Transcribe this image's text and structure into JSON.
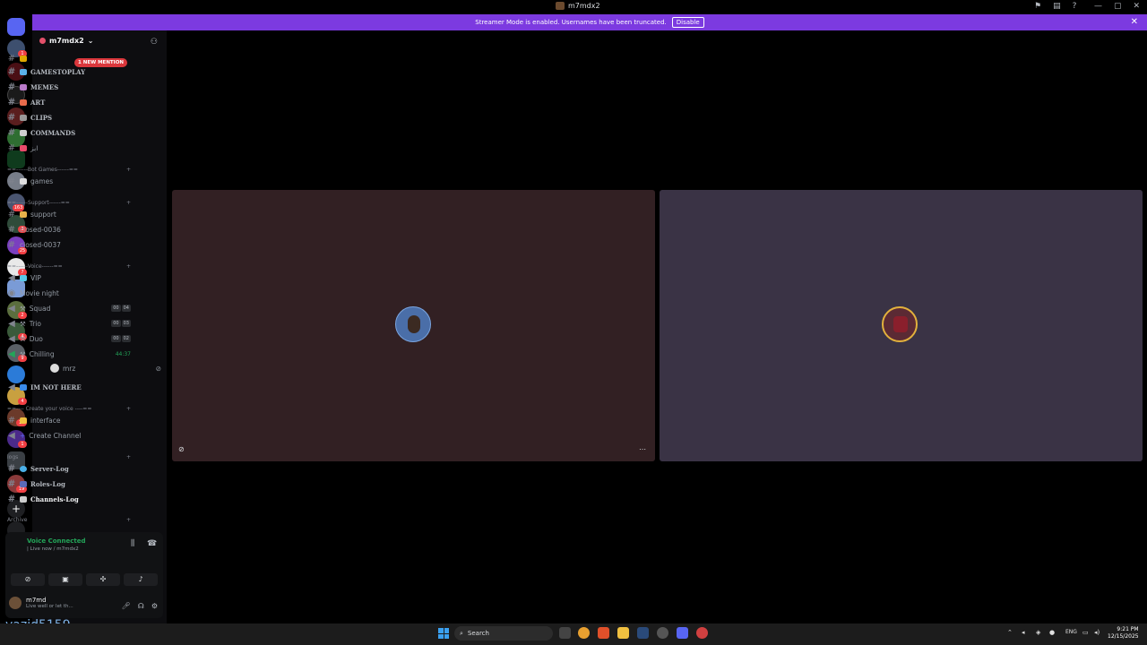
{
  "window": {
    "title": "m7mdx2"
  },
  "banner": {
    "text": "Streamer Mode is enabled. Usernames have been truncated.",
    "button": "Disable"
  },
  "server": {
    "name": "m7mdx2"
  },
  "mention_pill": "1 NEW MENTION",
  "guild_badges": [
    "1",
    "3",
    "163",
    "3",
    "25",
    "7",
    "2",
    "4",
    "9",
    "4",
    "18",
    "1",
    "19"
  ],
  "channels": {
    "top": [
      "GAMESTOPLAY",
      "MEMES",
      "ART",
      "CLIPS",
      "COMMANDS",
      "ابز"
    ],
    "cat_botgames": "==------Bot Games------==",
    "botgames": [
      "games"
    ],
    "cat_support": "==------Support------==",
    "support": [
      "support",
      "closed-0036",
      "closed-0037"
    ],
    "cat_voice": "==------Voice------==",
    "voice": [
      "VIP",
      "Movie night",
      "Squad",
      "Trio",
      "Duo",
      "Chilling"
    ],
    "voice_counts": [
      {
        "a": "00",
        "b": "04"
      },
      {
        "a": "00",
        "b": "03"
      },
      {
        "a": "00",
        "b": "02"
      }
    ],
    "chilling_timer": "44:37",
    "chilling_user": "mrz",
    "im_not_here": "IM NOT HERE",
    "cat_create": "==---- Create your voice ----==",
    "create": [
      "interface",
      "Create Channel"
    ],
    "cat_logs": "logs",
    "logs": [
      "Server-Log",
      "Roles-Log",
      "Channels-Log"
    ],
    "cat_archive": "Archive"
  },
  "voice_panel": {
    "status": "Voice Connected",
    "location": "| Live now / m7mdx2"
  },
  "user": {
    "name": "m7md",
    "status": "Live well or let th..."
  },
  "watermark": "yazid5159",
  "taskbar": {
    "search": "Search",
    "lang": "ENG",
    "time": "9:21 PM",
    "date": "12/15/2025"
  },
  "colors": {
    "accent": "#7c3ae0",
    "banner": "#7c3ae0",
    "voice_green": "#23a559",
    "mention_red": "#da373c"
  }
}
